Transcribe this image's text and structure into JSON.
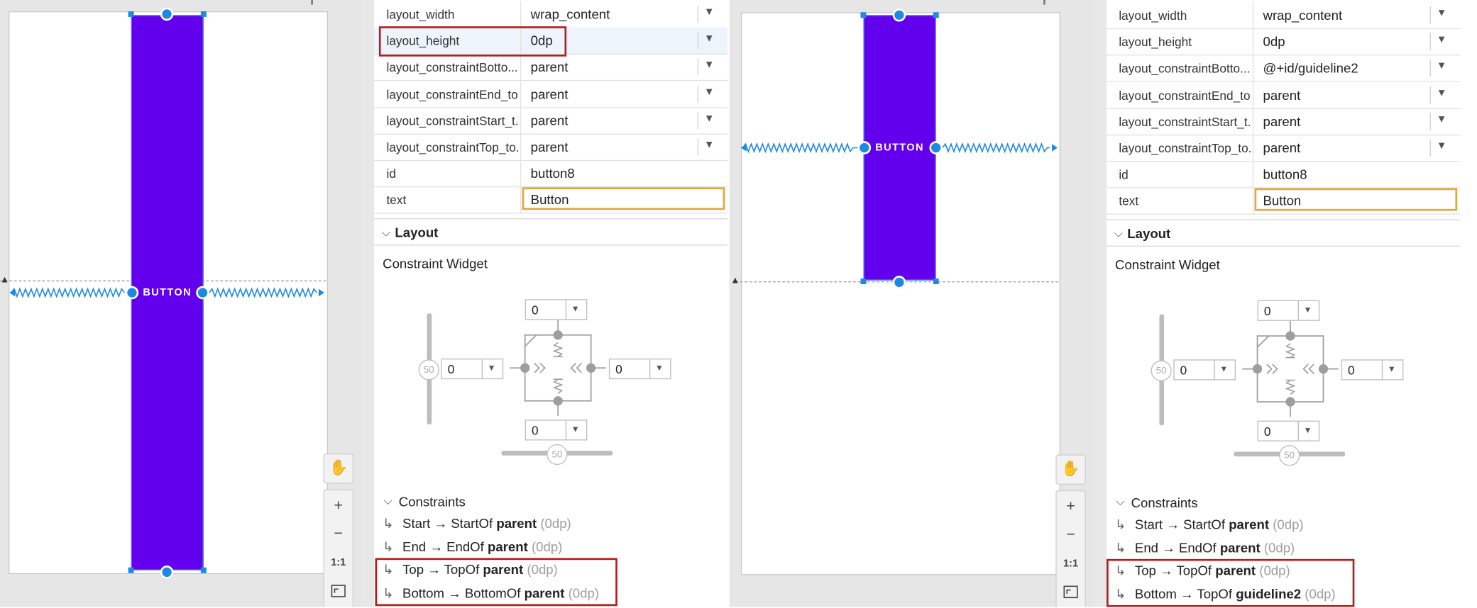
{
  "colors": {
    "accent": "#1e88e5",
    "button": "#6200ee",
    "highlight_red": "#b71c1c",
    "highlight_orange": "#e8a33a"
  },
  "left": {
    "preview": {
      "button_text": "BUTTON"
    },
    "toolbar": {
      "hand_icon": "hand-icon",
      "zoom_in": "+",
      "zoom_out": "−",
      "actual_size": "1:1",
      "fit_icon": "fit-screen-icon"
    },
    "attributes": [
      {
        "name": "layout_width",
        "value": "wrap_content",
        "dropdown": true
      },
      {
        "name": "layout_height",
        "value": "0dp",
        "dropdown": true
      },
      {
        "name": "layout_constraintBotto...",
        "value": "parent",
        "dropdown": true
      },
      {
        "name": "layout_constraintEnd_to...",
        "value": "parent",
        "dropdown": true
      },
      {
        "name": "layout_constraintStart_t...",
        "value": "parent",
        "dropdown": true
      },
      {
        "name": "layout_constraintTop_to...",
        "value": "parent",
        "dropdown": true
      },
      {
        "name": "id",
        "value": "button8",
        "dropdown": false
      },
      {
        "name": "text",
        "value": "Button",
        "dropdown": false
      }
    ],
    "layout_section": {
      "title": "Layout",
      "widget_title": "Constraint Widget",
      "top": "0",
      "left": "0",
      "right": "0",
      "bottom": "0",
      "bias_v": "50",
      "bias_h": "50"
    },
    "constraints_title": "Constraints",
    "constraints": [
      {
        "side": "Start",
        "arrow": "→",
        "target_side": "StartOf",
        "target": "parent",
        "margin": "(0dp)"
      },
      {
        "side": "End",
        "arrow": "→",
        "target_side": "EndOf",
        "target": "parent",
        "margin": "(0dp)"
      },
      {
        "side": "Top",
        "arrow": "→",
        "target_side": "TopOf",
        "target": "parent",
        "margin": "(0dp)"
      },
      {
        "side": "Bottom",
        "arrow": "→",
        "target_side": "BottomOf",
        "target": "parent",
        "margin": "(0dp)"
      }
    ]
  },
  "right": {
    "preview": {
      "button_text": "BUTTON"
    },
    "toolbar": {
      "hand_icon": "hand-icon",
      "zoom_in": "+",
      "zoom_out": "−",
      "actual_size": "1:1",
      "fit_icon": "fit-screen-icon"
    },
    "attributes": [
      {
        "name": "layout_width",
        "value": "wrap_content",
        "dropdown": true
      },
      {
        "name": "layout_height",
        "value": "0dp",
        "dropdown": true
      },
      {
        "name": "layout_constraintBotto...",
        "value": "@+id/guideline2",
        "dropdown": true
      },
      {
        "name": "layout_constraintEnd_to...",
        "value": "parent",
        "dropdown": true
      },
      {
        "name": "layout_constraintStart_t...",
        "value": "parent",
        "dropdown": true
      },
      {
        "name": "layout_constraintTop_to...",
        "value": "parent",
        "dropdown": true
      },
      {
        "name": "id",
        "value": "button8",
        "dropdown": false
      },
      {
        "name": "text",
        "value": "Button",
        "dropdown": false
      }
    ],
    "layout_section": {
      "title": "Layout",
      "widget_title": "Constraint Widget",
      "top": "0",
      "left": "0",
      "right": "0",
      "bottom": "0",
      "bias_v": "50",
      "bias_h": "50"
    },
    "constraints_title": "Constraints",
    "constraints": [
      {
        "side": "Start",
        "arrow": "→",
        "target_side": "StartOf",
        "target": "parent",
        "margin": "(0dp)"
      },
      {
        "side": "End",
        "arrow": "→",
        "target_side": "EndOf",
        "target": "parent",
        "margin": "(0dp)"
      },
      {
        "side": "Top",
        "arrow": "→",
        "target_side": "TopOf",
        "target": "parent",
        "margin": "(0dp)"
      },
      {
        "side": "Bottom",
        "arrow": "→",
        "target_side": "TopOf",
        "target": "guideline2",
        "margin": "(0dp)"
      }
    ]
  }
}
